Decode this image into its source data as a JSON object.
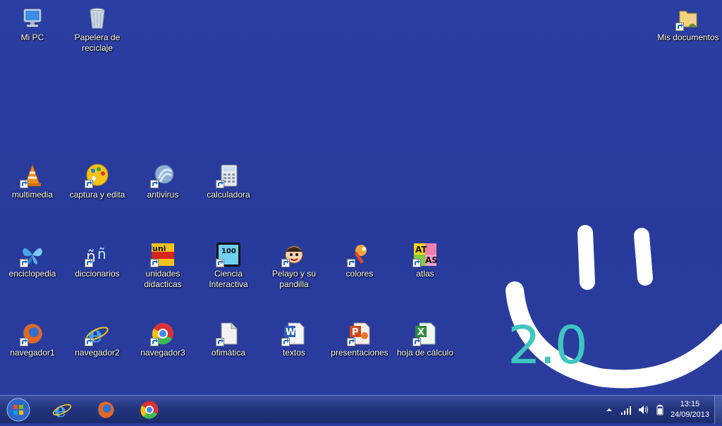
{
  "desktop": {
    "background_color": "#2a3c9e",
    "icons": {
      "mi_pc": "Mi PC",
      "papelera": "Papelera de reciclaje",
      "mis_documentos": "Mis documentos",
      "multimedia": "multimedia",
      "captura": "captura y edita",
      "antivirus": "antivirus",
      "calculadora": "calculadora",
      "enciclopedia": "enciclopedia",
      "diccionarios": "diccionarios",
      "unidades": "unidades didacticas",
      "ciencia": "Ciencia Interactiva",
      "pelayo": "Pelayo y su pandilla",
      "colores": "colores",
      "atlas": "atlas",
      "navegador1": "navegador1",
      "navegador2": "navegador2",
      "navegador3": "navegador3",
      "ofimatica": "ofimática",
      "textos": "textos",
      "presentaciones": "presentaciones",
      "hoja": "hoja de cálculo"
    },
    "wallpaper_badge": "2.0",
    "accent_color": "#3ec6c0"
  },
  "taskbar": {
    "pinned": [
      "internet-explorer",
      "firefox",
      "chrome"
    ],
    "clock_time": "13:15",
    "clock_date": "24/09/2013"
  }
}
